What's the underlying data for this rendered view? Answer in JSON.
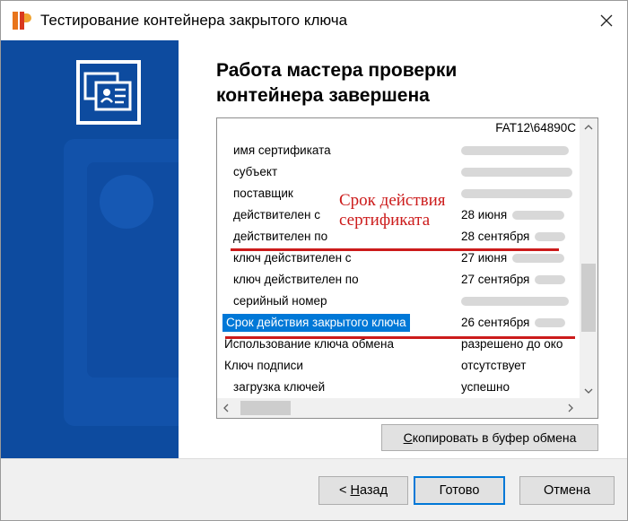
{
  "window": {
    "title": "Тестирование контейнера закрытого ключа"
  },
  "content": {
    "heading_line1": "Работа мастера проверки",
    "heading_line2": "контейнера завершена"
  },
  "list": {
    "header_path": "FAT12\\64890C",
    "rows": [
      {
        "name": "имя сертификата",
        "value": ""
      },
      {
        "name": "субъект",
        "value": ""
      },
      {
        "name": "поставщик",
        "value": ""
      },
      {
        "name": "действителен с",
        "value": "28 июня"
      },
      {
        "name": "действителен по",
        "value": "28 сентября"
      },
      {
        "name": "ключ действителен с",
        "value": "27 июня"
      },
      {
        "name": "ключ действителен по",
        "value": "27 сентября"
      },
      {
        "name": "серийный номер",
        "value": ""
      },
      {
        "name": "Срок действия закрытого ключа",
        "value": "26 сентября"
      },
      {
        "name": "Использование ключа обмена",
        "value": "разрешено до око"
      },
      {
        "name": "Ключ подписи",
        "value": "отсутствует"
      },
      {
        "name": "загрузка ключей",
        "value": "успешно"
      }
    ]
  },
  "annotation": {
    "line1": "Срок действия",
    "line2": "сертификата",
    "color": "#cc1b1b"
  },
  "buttons": {
    "copy_prefix": "С",
    "copy_rest": "копировать в буфер обмена",
    "back_arrow": "< ",
    "back_underlined": "Н",
    "back_rest": "азад",
    "done": "Готово",
    "cancel": "Отмена"
  },
  "icons": {
    "app": "cryptopro-icon",
    "close": "close-icon",
    "banner": "certificate-icon"
  },
  "colors": {
    "banner": "#0d4b9f",
    "selection": "#0078d7",
    "annotation": "#cc1b1b"
  }
}
